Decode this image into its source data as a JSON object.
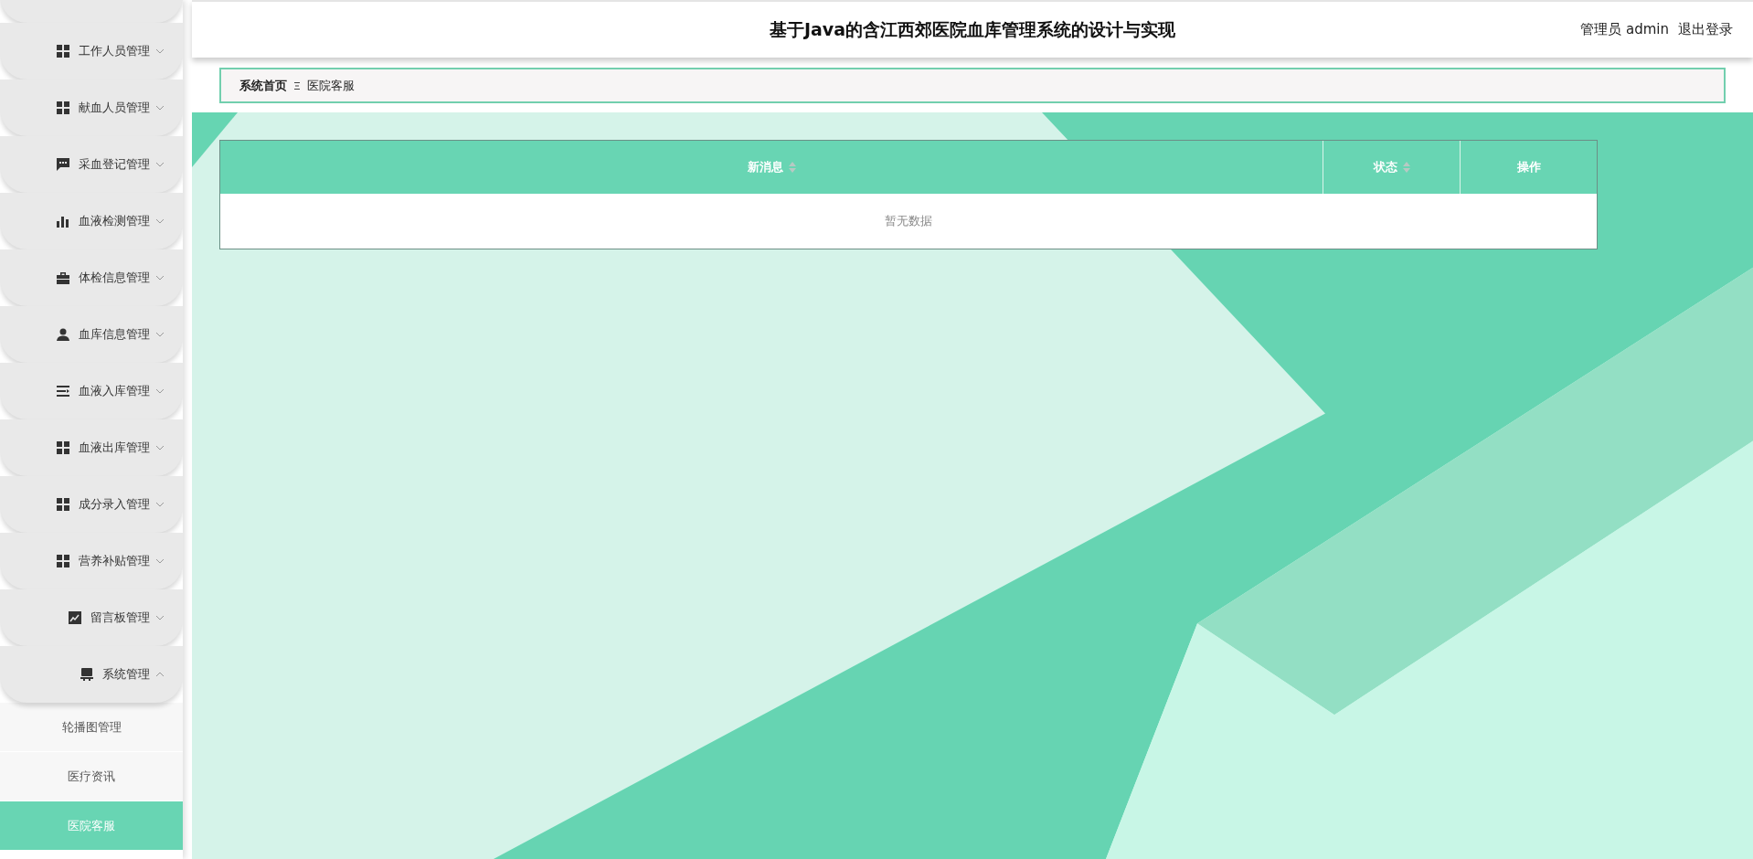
{
  "header": {
    "title": "基于Java的含江西郊医院血库管理系统的设计与实现",
    "user": "管理员 admin",
    "logout": "退出登录"
  },
  "sidebar": {
    "items": [
      {
        "label": "工作人员管理",
        "expanded": false
      },
      {
        "label": "献血人员管理",
        "expanded": false
      },
      {
        "label": "采血登记管理",
        "expanded": false
      },
      {
        "label": "血液检测管理",
        "expanded": false
      },
      {
        "label": "体检信息管理",
        "expanded": false
      },
      {
        "label": "血库信息管理",
        "expanded": false
      },
      {
        "label": "血液入库管理",
        "expanded": false
      },
      {
        "label": "血液出库管理",
        "expanded": false
      },
      {
        "label": "成分录入管理",
        "expanded": false
      },
      {
        "label": "营养补贴管理",
        "expanded": false
      },
      {
        "label": "留言板管理",
        "expanded": false
      },
      {
        "label": "系统管理",
        "expanded": true,
        "children": [
          {
            "label": "轮播图管理",
            "selected": false
          },
          {
            "label": "医疗资讯",
            "selected": false
          },
          {
            "label": "医院客服",
            "selected": true
          }
        ]
      }
    ]
  },
  "breadcrumb": {
    "home": "系统首页",
    "current": "医院客服"
  },
  "table": {
    "columns": [
      {
        "label": "新消息",
        "sortable": true
      },
      {
        "label": "状态",
        "sortable": true
      },
      {
        "label": "操作",
        "sortable": false
      }
    ],
    "empty_text": "暂无数据"
  }
}
